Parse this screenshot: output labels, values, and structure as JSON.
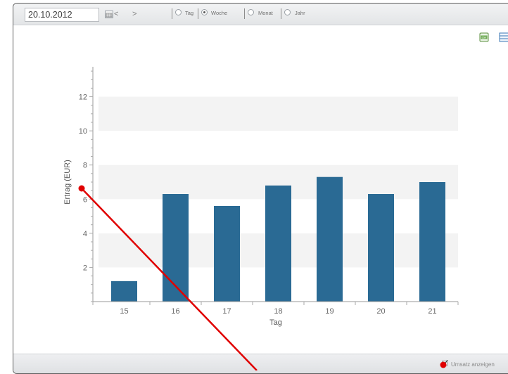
{
  "toolbar": {
    "date_value": "20.10.2012",
    "prev_label": "<",
    "next_label": ">",
    "period_options": [
      {
        "label": "Tag",
        "selected": false
      },
      {
        "label": "Woche",
        "selected": true
      },
      {
        "label": "Monat",
        "selected": false
      },
      {
        "label": "Jahr",
        "selected": false
      }
    ],
    "icons": [
      "calendar-icon",
      "csv-export-icon",
      "table-view-icon"
    ]
  },
  "chart_data": {
    "type": "bar",
    "categories": [
      "15",
      "16",
      "17",
      "18",
      "19",
      "20",
      "21"
    ],
    "values": [
      1.2,
      6.3,
      5.6,
      6.8,
      7.3,
      6.3,
      7.0
    ],
    "xlabel": "Tag",
    "ylabel": "Ertrag (EUR)",
    "ylim": [
      0,
      14
    ],
    "yticks": [
      2,
      4,
      6,
      8,
      10,
      12
    ],
    "bar_color": "#2a6a94",
    "band_color": "#f3f3f3",
    "banded_background": true
  },
  "footer": {
    "umsatz_label": "Umsatz anzeigen",
    "umsatz_checked": true
  },
  "colors": {
    "annotation": "#e00000"
  }
}
